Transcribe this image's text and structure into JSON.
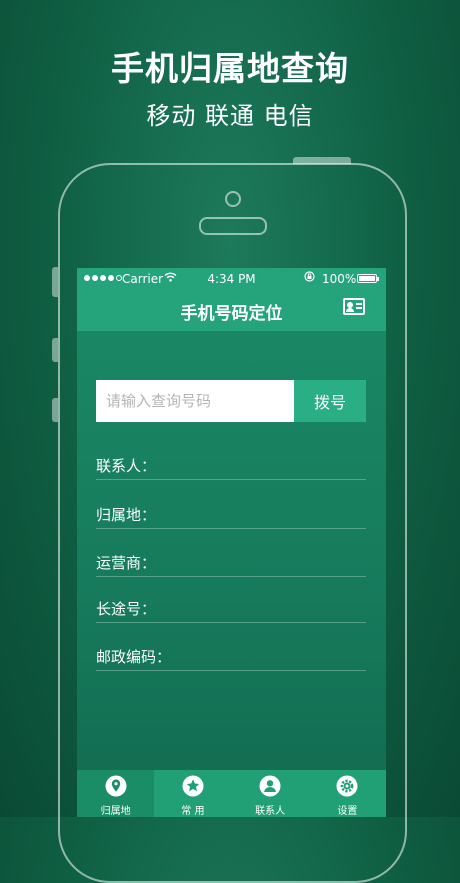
{
  "promo": {
    "title": "手机归属地查询",
    "subtitle": "移动 联通 电信"
  },
  "status_bar": {
    "carrier": "Carrier",
    "time": "4:34 PM",
    "battery": "100%"
  },
  "nav": {
    "title": "手机号码定位",
    "right_icon": "contact-card-icon"
  },
  "search": {
    "placeholder": "请输入查询号码",
    "value": "",
    "dial_label": "拨号"
  },
  "fields": [
    {
      "label": "联系人：",
      "value": ""
    },
    {
      "label": "归属地：",
      "value": ""
    },
    {
      "label": "运营商：",
      "value": ""
    },
    {
      "label": "长途号：",
      "value": ""
    },
    {
      "label": "邮政编码：",
      "value": ""
    }
  ],
  "tabs": [
    {
      "label": "归属地",
      "icon": "location-pin-icon",
      "active": true
    },
    {
      "label": "常 用",
      "icon": "star-icon",
      "active": false
    },
    {
      "label": "联系人",
      "icon": "person-icon",
      "active": false
    },
    {
      "label": "设置",
      "icon": "gear-icon",
      "active": false
    }
  ],
  "colors": {
    "accent": "#25a37a",
    "dial_button": "#2aae83",
    "background": "#0f5f43"
  }
}
